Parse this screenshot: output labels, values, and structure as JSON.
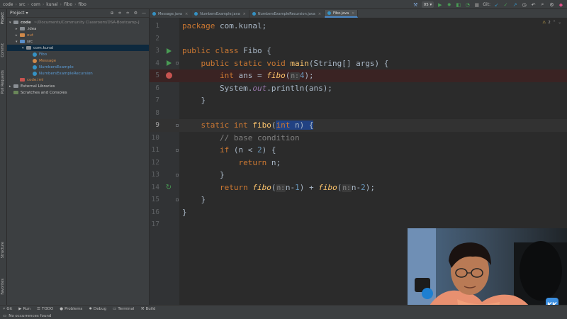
{
  "breadcrumbs": [
    "code",
    "src",
    "com",
    "kunal",
    "Fibo",
    "fibo"
  ],
  "run_config": "05",
  "vcs_label": "Git:",
  "project": {
    "title": "Project",
    "tree": [
      {
        "name": "code",
        "path": "~/Documents/Community Classroom/DSA-Bootcamp-J",
        "depth": 0,
        "open": true,
        "kind": "folder"
      },
      {
        "name": ".idea",
        "depth": 1,
        "open": false,
        "kind": "folder"
      },
      {
        "name": "out",
        "depth": 1,
        "open": false,
        "kind": "folder-orange"
      },
      {
        "name": "src",
        "depth": 1,
        "open": true,
        "kind": "folder-blue"
      },
      {
        "name": "com.kunal",
        "depth": 2,
        "open": true,
        "kind": "package",
        "selected": true
      },
      {
        "name": "Fibo",
        "depth": 3,
        "kind": "class"
      },
      {
        "name": "Message",
        "depth": 3,
        "kind": "class-orange"
      },
      {
        "name": "NumbersExample",
        "depth": 3,
        "kind": "class"
      },
      {
        "name": "NumbersExampleRecursion",
        "depth": 3,
        "kind": "class"
      },
      {
        "name": "code.iml",
        "depth": 1,
        "kind": "iml"
      },
      {
        "name": "External Libraries",
        "depth": 0,
        "open": false,
        "kind": "lib"
      },
      {
        "name": "Scratches and Consoles",
        "depth": 0,
        "kind": "scratch"
      }
    ]
  },
  "tabs": [
    {
      "label": "Message.java",
      "active": false
    },
    {
      "label": "NumbersExample.java",
      "active": false
    },
    {
      "label": "NumbersExampleRecursion.java",
      "active": false
    },
    {
      "label": "Fibo.java",
      "active": true
    }
  ],
  "inspection": {
    "warnings": "2"
  },
  "left_tool_labels": [
    "Project",
    "Commit",
    "Pull Requests",
    "Structure",
    "Favorites"
  ],
  "code_lines": [
    {
      "n": "1",
      "parts": [
        [
          "kw",
          "package "
        ],
        [
          "t",
          "com.kunal;"
        ]
      ]
    },
    {
      "n": "2",
      "parts": []
    },
    {
      "n": "3",
      "parts": [
        [
          "kw",
          "public class "
        ],
        [
          "t",
          "Fibo {"
        ]
      ]
    },
    {
      "n": "4",
      "parts": [
        [
          "t",
          "    "
        ],
        [
          "kw",
          "public static void "
        ],
        [
          "fn",
          "main"
        ],
        [
          "t",
          "(String[] args) {"
        ]
      ]
    },
    {
      "n": "5",
      "parts": [
        [
          "t",
          "        "
        ],
        [
          "kw",
          "int "
        ],
        [
          "t",
          "ans = "
        ],
        [
          "fi",
          "fibo"
        ],
        [
          "t",
          "("
        ],
        [
          "h",
          "n:"
        ],
        [
          "num",
          "4"
        ],
        [
          "t",
          ");"
        ]
      ]
    },
    {
      "n": "6",
      "parts": [
        [
          "t",
          "        System."
        ],
        [
          "st",
          "out"
        ],
        [
          "t",
          ".println(ans);"
        ]
      ]
    },
    {
      "n": "7",
      "parts": [
        [
          "t",
          "    }"
        ]
      ]
    },
    {
      "n": "8",
      "parts": []
    },
    {
      "n": "9",
      "parts": [
        [
          "t",
          "    "
        ],
        [
          "kw",
          "static int "
        ],
        [
          "fn",
          "fibo"
        ],
        [
          "t",
          "("
        ],
        [
          "kw",
          "int "
        ],
        [
          "t",
          "n) {"
        ]
      ]
    },
    {
      "n": "10",
      "parts": [
        [
          "t",
          "        "
        ],
        [
          "com",
          "// base condition"
        ]
      ]
    },
    {
      "n": "11",
      "parts": [
        [
          "t",
          "        "
        ],
        [
          "kw",
          "if "
        ],
        [
          "t",
          "(n < "
        ],
        [
          "num",
          "2"
        ],
        [
          "t",
          ") {"
        ]
      ]
    },
    {
      "n": "12",
      "parts": [
        [
          "t",
          "            "
        ],
        [
          "kw",
          "return "
        ],
        [
          "t",
          "n;"
        ]
      ]
    },
    {
      "n": "13",
      "parts": [
        [
          "t",
          "        }"
        ]
      ]
    },
    {
      "n": "14",
      "parts": [
        [
          "t",
          "        "
        ],
        [
          "kw",
          "return "
        ],
        [
          "fi",
          "fibo"
        ],
        [
          "t",
          "("
        ],
        [
          "h",
          "n:"
        ],
        [
          "t",
          "n-"
        ],
        [
          "num",
          "1"
        ],
        [
          "t",
          ") + "
        ],
        [
          "fi",
          "fibo"
        ],
        [
          "t",
          "("
        ],
        [
          "h",
          "n:"
        ],
        [
          "t",
          "n-"
        ],
        [
          "num",
          "2"
        ],
        [
          "t",
          ");"
        ]
      ]
    },
    {
      "n": "15",
      "parts": [
        [
          "t",
          "    }"
        ]
      ]
    },
    {
      "n": "16",
      "parts": [
        [
          "t",
          "}"
        ]
      ]
    },
    {
      "n": "17",
      "parts": []
    }
  ],
  "tool_windows": [
    "Git",
    "Run",
    "TODO",
    "Problems",
    "Debug",
    "Terminal",
    "Build"
  ],
  "status_message": "No occurrences found",
  "colors": {
    "accent": "#4a88c7",
    "breakpoint": "#c75450",
    "run": "#499c54"
  }
}
